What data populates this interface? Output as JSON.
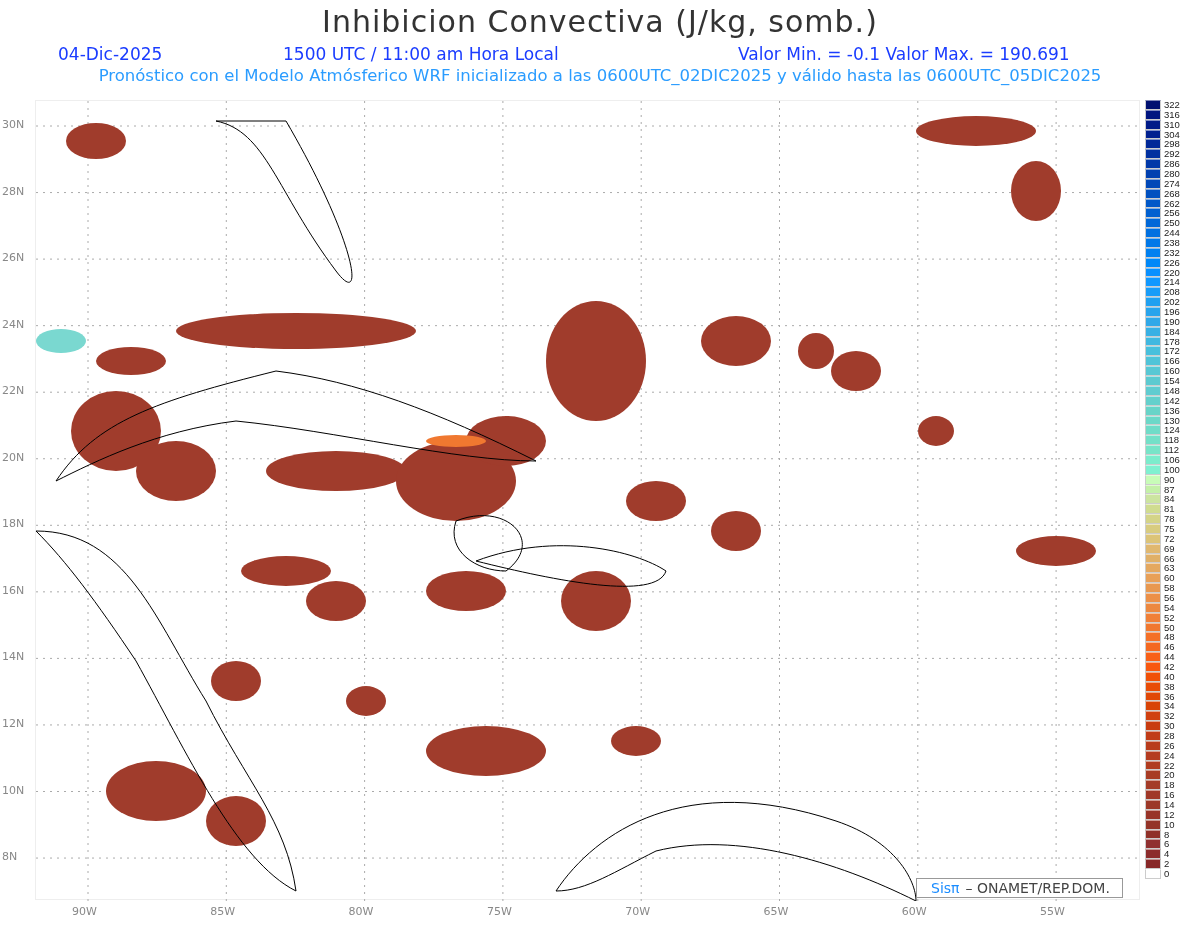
{
  "title": "Inhibicion Convectiva (J/kg, somb.)",
  "info": {
    "date": "04-Dic-2025",
    "time": "1500 UTC / 11:00 am Hora Local",
    "range": "Valor Min. = -0.1  Valor Max. = 190.691"
  },
  "subtitle": "Pronóstico con el Modelo Atmósferico WRF inicializado a las 0600UTC_02DIC2025 y válido hasta las  0600UTC_05DIC2025",
  "map": {
    "lat_labels": [
      "30N",
      "28N",
      "26N",
      "24N",
      "22N",
      "20N",
      "18N",
      "16N",
      "14N",
      "12N",
      "10N",
      "8N"
    ],
    "lon_labels": [
      "90W",
      "85W",
      "80W",
      "75W",
      "70W",
      "65W",
      "60W",
      "55W"
    ],
    "credit": {
      "logo": "Sisπ",
      "text": "– ONAMET/REP.DOM."
    }
  },
  "colorbar": {
    "levels": [
      {
        "label": "322",
        "color": "#001070"
      },
      {
        "label": "316",
        "color": "#001580"
      },
      {
        "label": "310",
        "color": "#001a88"
      },
      {
        "label": "304",
        "color": "#002090"
      },
      {
        "label": "298",
        "color": "#002898"
      },
      {
        "label": "292",
        "color": "#0030a0"
      },
      {
        "label": "286",
        "color": "#0038a8"
      },
      {
        "label": "280",
        "color": "#0040b0"
      },
      {
        "label": "274",
        "color": "#0048b8"
      },
      {
        "label": "268",
        "color": "#0050c0"
      },
      {
        "label": "262",
        "color": "#0058c8"
      },
      {
        "label": "256",
        "color": "#0060d0"
      },
      {
        "label": "250",
        "color": "#0068d8"
      },
      {
        "label": "244",
        "color": "#0070e0"
      },
      {
        "label": "238",
        "color": "#0078e8"
      },
      {
        "label": "232",
        "color": "#0080f0"
      },
      {
        "label": "226",
        "color": "#0088f8"
      },
      {
        "label": "220",
        "color": "#0890ff"
      },
      {
        "label": "214",
        "color": "#1098ff"
      },
      {
        "label": "208",
        "color": "#189cf8"
      },
      {
        "label": "202",
        "color": "#20a0f0"
      },
      {
        "label": "196",
        "color": "#28a4ec"
      },
      {
        "label": "190",
        "color": "#30a8e8"
      },
      {
        "label": "184",
        "color": "#38b0e4"
      },
      {
        "label": "178",
        "color": "#40b8e0"
      },
      {
        "label": "172",
        "color": "#48c0dc"
      },
      {
        "label": "166",
        "color": "#50c4d8"
      },
      {
        "label": "160",
        "color": "#58c8d4"
      },
      {
        "label": "154",
        "color": "#5ccad0"
      },
      {
        "label": "148",
        "color": "#60ccd0"
      },
      {
        "label": "142",
        "color": "#64d0cc"
      },
      {
        "label": "136",
        "color": "#68d4c8"
      },
      {
        "label": "130",
        "color": "#6cd8c8"
      },
      {
        "label": "124",
        "color": "#70dcc8"
      },
      {
        "label": "118",
        "color": "#74e0c8"
      },
      {
        "label": "112",
        "color": "#78e4c8"
      },
      {
        "label": "106",
        "color": "#7ceccc"
      },
      {
        "label": "100",
        "color": "#80f0d0"
      },
      {
        "label": "90",
        "color": "#c8fcb8"
      },
      {
        "label": "87",
        "color": "#c4f0a8"
      },
      {
        "label": "84",
        "color": "#cce4a0"
      },
      {
        "label": "81",
        "color": "#d0dc90"
      },
      {
        "label": "78",
        "color": "#d4d488"
      },
      {
        "label": "75",
        "color": "#d8cc80"
      },
      {
        "label": "72",
        "color": "#dcc478"
      },
      {
        "label": "69",
        "color": "#e0b870"
      },
      {
        "label": "66",
        "color": "#e0b068"
      },
      {
        "label": "63",
        "color": "#e4a860"
      },
      {
        "label": "60",
        "color": "#e8a058"
      },
      {
        "label": "58",
        "color": "#e89850"
      },
      {
        "label": "56",
        "color": "#ec9048"
      },
      {
        "label": "54",
        "color": "#ec8840"
      },
      {
        "label": "52",
        "color": "#f08038"
      },
      {
        "label": "50",
        "color": "#f07830"
      },
      {
        "label": "48",
        "color": "#f47028"
      },
      {
        "label": "46",
        "color": "#f46820"
      },
      {
        "label": "44",
        "color": "#f86018"
      },
      {
        "label": "42",
        "color": "#f85810"
      },
      {
        "label": "40",
        "color": "#f05008"
      },
      {
        "label": "38",
        "color": "#e84c08"
      },
      {
        "label": "36",
        "color": "#e04808"
      },
      {
        "label": "34",
        "color": "#d84408"
      },
      {
        "label": "32",
        "color": "#d04010"
      },
      {
        "label": "30",
        "color": "#c83c10"
      },
      {
        "label": "28",
        "color": "#c03c18"
      },
      {
        "label": "26",
        "color": "#b83c1c"
      },
      {
        "label": "24",
        "color": "#b43c20"
      },
      {
        "label": "22",
        "color": "#b03c20"
      },
      {
        "label": "20",
        "color": "#a83c24"
      },
      {
        "label": "18",
        "color": "#a43c28"
      },
      {
        "label": "16",
        "color": "#a03828"
      },
      {
        "label": "14",
        "color": "#9c3828"
      },
      {
        "label": "12",
        "color": "#983428"
      },
      {
        "label": "10",
        "color": "#943428"
      },
      {
        "label": "8",
        "color": "#903028"
      },
      {
        "label": "6",
        "color": "#903030"
      },
      {
        "label": "4",
        "color": "#8c2c2c"
      },
      {
        "label": "2",
        "color": "#882828"
      },
      {
        "label": "0",
        "color": "#ffffff"
      }
    ]
  }
}
